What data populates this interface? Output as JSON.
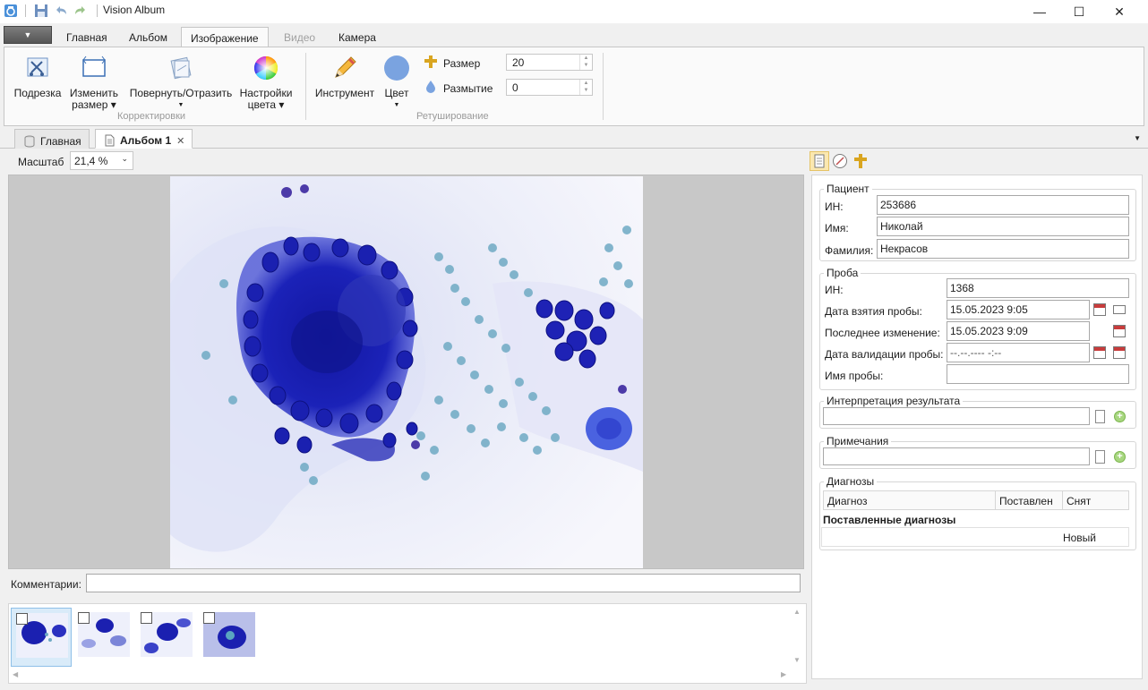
{
  "app": {
    "title": "Vision Album",
    "menu_arrow": "▼",
    "window_buttons": {
      "minimize": "—",
      "maximize": "☐",
      "close": "✕"
    }
  },
  "ribbon": {
    "tabs": [
      {
        "label": "Главная",
        "state": "normal"
      },
      {
        "label": "Альбом",
        "state": "normal"
      },
      {
        "label": "Изображение",
        "state": "active"
      },
      {
        "label": "Видео",
        "state": "disabled"
      },
      {
        "label": "Камера",
        "state": "normal"
      }
    ],
    "groups": {
      "correct": {
        "label": "Корректировки",
        "buttons": [
          {
            "label": "Подрезка",
            "icon": "crop-icon"
          },
          {
            "label": "Изменить размер",
            "icon": "resize-icon",
            "dropdown": true
          },
          {
            "label": "Повернуть/Отразить",
            "icon": "rotate-icon",
            "dropdown": true
          },
          {
            "label": "Настройки цвета",
            "icon": "color-wheel-icon",
            "dropdown": true
          }
        ]
      },
      "retouch": {
        "label": "Ретуширование",
        "instrument": "Инструмент",
        "color": "Цвет",
        "size_label": "Размер",
        "size_value": "20",
        "blur_label": "Размытие",
        "blur_value": "0"
      }
    }
  },
  "doc_tabs": [
    {
      "label": "Главная",
      "icon": "database-icon",
      "active": false
    },
    {
      "label": "Альбом 1",
      "icon": "document-icon",
      "active": true,
      "close": "✕"
    }
  ],
  "viewer": {
    "zoom_label": "Масштаб",
    "zoom_value": "21,4 %",
    "comment_label": "Комментарии:",
    "comment_value": "",
    "thumbnails": [
      {
        "selected": true,
        "checked": false
      },
      {
        "selected": false,
        "checked": false
      },
      {
        "selected": false,
        "checked": false
      },
      {
        "selected": false,
        "checked": false
      }
    ]
  },
  "patient": {
    "legend": "Пациент",
    "id_label": "ИН:",
    "id_value": "253686",
    "name_label": "Имя:",
    "name_value": "Николай",
    "surname_label": "Фамилия:",
    "surname_value": "Некрасов"
  },
  "sample": {
    "legend": "Проба",
    "id_label": "ИН:",
    "id_value": "1368",
    "taken_label": "Дата взятия пробы:",
    "taken_value": "15.05.2023 9:05",
    "modified_label": "Последнее изменение:",
    "modified_value": "15.05.2023 9:09",
    "validation_label": "Дата валидации пробы:",
    "validation_value": "--.--.---- -:--",
    "name_label": "Имя пробы:",
    "name_value": ""
  },
  "interpretation": {
    "legend": "Интерпретация результата",
    "value": ""
  },
  "notes": {
    "legend": "Примечания",
    "value": ""
  },
  "diagnoses": {
    "legend": "Диагнозы",
    "columns": [
      "Диагноз",
      "Поставлен",
      "Снят"
    ],
    "section_title": "Поставленные диагнозы",
    "new_label": "Новый"
  },
  "colors": {
    "accent_tab_border": "#c6c6c6",
    "stain_dark": "#1b1fb0",
    "stain_light": "#5aa5c0",
    "background_slide": "#f2f2fb"
  }
}
